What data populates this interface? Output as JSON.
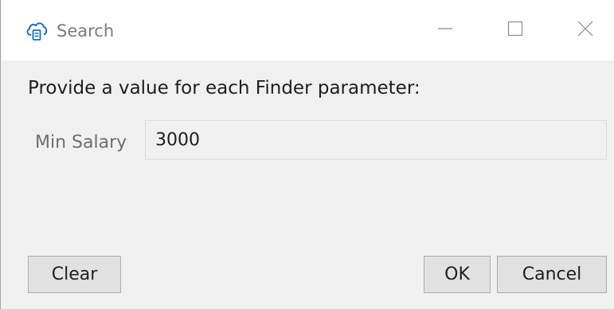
{
  "window": {
    "title": "Search",
    "app_icon": "cloud-database-icon",
    "controls": {
      "minimize_icon": "minimize-icon",
      "maximize_icon": "maximize-icon",
      "close_icon": "close-icon"
    }
  },
  "dialog": {
    "prompt": "Provide a value for each Finder parameter:",
    "fields": [
      {
        "label": "Min Salary",
        "value": "3000"
      }
    ]
  },
  "buttons": {
    "clear_label": "Clear",
    "ok_label": "OK",
    "cancel_label": "Cancel"
  },
  "colors": {
    "accent": "#1e6fb5",
    "background": "#f0f0f0",
    "titlebar": "#ffffff"
  }
}
